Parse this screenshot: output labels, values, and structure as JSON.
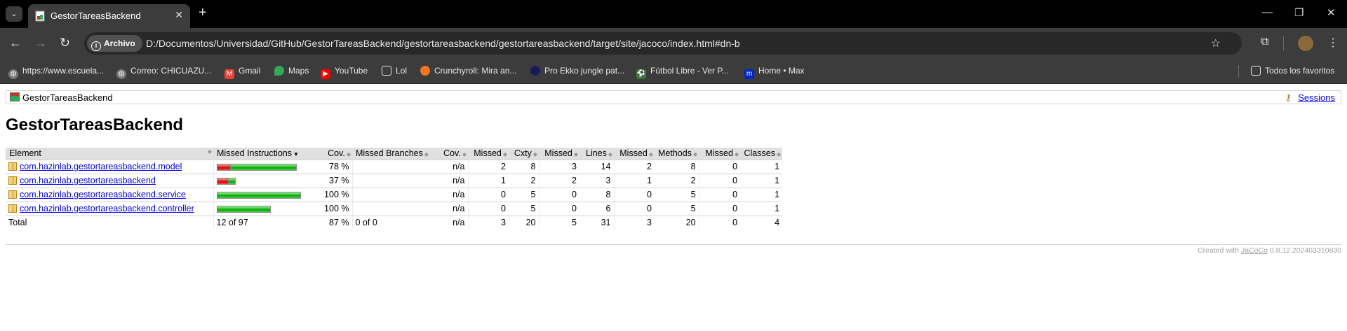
{
  "browser": {
    "tab_title": "GestorTareasBackend",
    "url_chip": "Archivo",
    "url": "D:/Documentos/Universidad/GitHub/GestorTareasBackend/gestortareasbackend/gestortareasbackend/target/site/jacoco/index.html#dn-b",
    "bookmarks": [
      {
        "label": "https://www.escuela...",
        "icon": "globe-icon"
      },
      {
        "label": "Correo: CHICUAZU...",
        "icon": "globe-icon"
      },
      {
        "label": "Gmail",
        "icon": "gmail-icon"
      },
      {
        "label": "Maps",
        "icon": "maps-icon"
      },
      {
        "label": "YouTube",
        "icon": "youtube-icon"
      },
      {
        "label": "Lol",
        "icon": "folder-icon"
      },
      {
        "label": "Crunchyroll: Mira an...",
        "icon": "crunchyroll-icon"
      },
      {
        "label": "Pro Ekko jungle pat...",
        "icon": "ekko-icon"
      },
      {
        "label": "Fútbol Libre - Ver P...",
        "icon": "futbol-icon"
      },
      {
        "label": "Home • Max",
        "icon": "max-icon"
      }
    ],
    "all_bookmarks": "Todos los favoritos"
  },
  "page": {
    "breadcrumb": "GestorTareasBackend",
    "sessions_link": "Sessions",
    "title": "GestorTareasBackend",
    "columns": [
      "Element",
      "Missed Instructions",
      "Cov.",
      "Missed Branches",
      "Cov.",
      "Missed",
      "Cxty",
      "Missed",
      "Lines",
      "Missed",
      "Methods",
      "Missed",
      "Classes"
    ],
    "rows": [
      {
        "element": "com.hazinlab.gestortareasbackend.model",
        "missed_instr_red": 0.176,
        "missed_instr_green": 0.824,
        "bar_scale": 0.95,
        "cov": "78 %",
        "branches": "",
        "bcov": "n/a",
        "missed_cxty": "2",
        "cxty": "8",
        "missed_lines": "3",
        "lines": "14",
        "missed_methods": "2",
        "methods": "8",
        "missed_classes": "0",
        "classes": "1"
      },
      {
        "element": "com.hazinlab.gestortareasbackend",
        "missed_instr_red": 0.63,
        "missed_instr_green": 0.37,
        "bar_scale": 0.23,
        "cov": "37 %",
        "branches": "",
        "bcov": "n/a",
        "missed_cxty": "1",
        "cxty": "2",
        "missed_lines": "2",
        "lines": "3",
        "missed_methods": "1",
        "methods": "2",
        "missed_classes": "0",
        "classes": "1"
      },
      {
        "element": "com.hazinlab.gestortareasbackend.service",
        "missed_instr_red": 0,
        "missed_instr_green": 1,
        "bar_scale": 1.0,
        "cov": "100 %",
        "branches": "",
        "bcov": "n/a",
        "missed_cxty": "0",
        "cxty": "5",
        "missed_lines": "0",
        "lines": "8",
        "missed_methods": "0",
        "methods": "5",
        "missed_classes": "0",
        "classes": "1"
      },
      {
        "element": "com.hazinlab.gestortareasbackend.controller",
        "missed_instr_red": 0,
        "missed_instr_green": 1,
        "bar_scale": 0.64,
        "cov": "100 %",
        "branches": "",
        "bcov": "n/a",
        "missed_cxty": "0",
        "cxty": "5",
        "missed_lines": "0",
        "lines": "6",
        "missed_methods": "0",
        "methods": "5",
        "missed_classes": "0",
        "classes": "1"
      }
    ],
    "total": {
      "label": "Total",
      "missed_instr": "12 of 97",
      "cov": "87 %",
      "branches": "0 of 0",
      "bcov": "n/a",
      "missed_cxty": "3",
      "cxty": "20",
      "missed_lines": "5",
      "lines": "31",
      "missed_methods": "3",
      "methods": "20",
      "missed_classes": "0",
      "classes": "4"
    },
    "footer_prefix": "Created with",
    "footer_link": "JaCoCo",
    "footer_version": "0.8.12.202403310830"
  }
}
